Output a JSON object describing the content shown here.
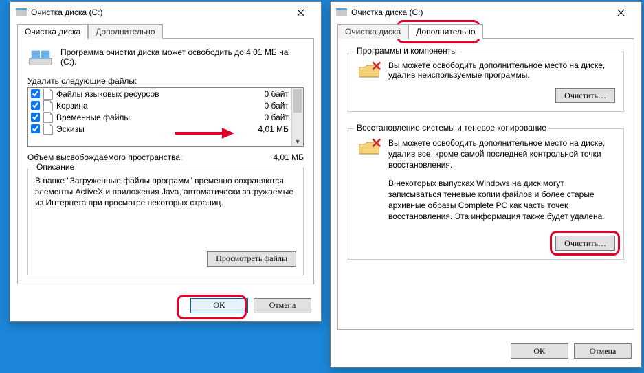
{
  "left_window": {
    "title": "Очистка диска  (C:)",
    "tabs": {
      "main": "Очистка диска",
      "advanced": "Дополнительно"
    },
    "intro": "Программа очистки диска может освободить до 4,01 МБ на  (C:).",
    "remove_label": "Удалить следующие файлы:",
    "files": [
      {
        "name": "Файлы языковых ресурсов",
        "size": "0 байт",
        "checked": true
      },
      {
        "name": "Корзина",
        "size": "0 байт",
        "checked": true
      },
      {
        "name": "Временные файлы",
        "size": "0 байт",
        "checked": true
      },
      {
        "name": "Эскизы",
        "size": "4,01 МБ",
        "checked": true
      }
    ],
    "freed_label": "Объем высвобождаемого пространства:",
    "freed_value": "4,01 МБ",
    "description_title": "Описание",
    "description_text": "В папке \"Загруженные файлы программ\" временно сохраняются элементы ActiveX и приложения Java, автоматически загружаемые из Интернета при просмотре некоторых страниц.",
    "view_files_btn": "Просмотреть файлы",
    "ok_btn": "OK",
    "cancel_btn": "Отмена"
  },
  "right_window": {
    "title": "Очистка диска  (C:)",
    "tabs": {
      "main": "Очистка диска",
      "advanced": "Дополнительно"
    },
    "group1_title": "Программы и компоненты",
    "group1_text": "Вы можете освободить дополнительное место на диске, удалив неиспользуемые программы.",
    "group2_title": "Восстановление системы и теневое копирование",
    "group2_text1": "Вы можете освободить дополнительное место на диске, удалив все, кроме самой последней контрольной точки восстановления.",
    "group2_text2": "В некоторых выпусках Windows на диск могут записываться теневые копии файлов и более старые архивные образы Complete PC как часть точек восстановления. Эта информация также будет удалена.",
    "clean_btn": "Очистить…",
    "ok_btn": "OK",
    "cancel_btn": "Отмена"
  }
}
